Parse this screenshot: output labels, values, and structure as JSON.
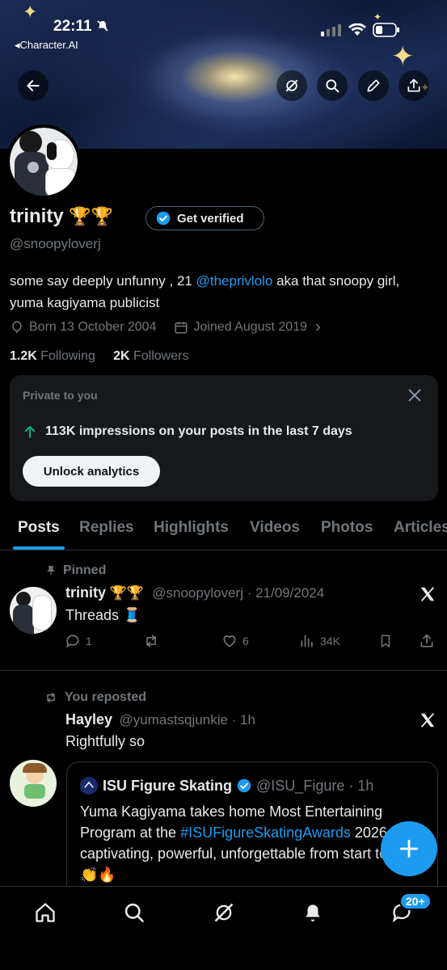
{
  "status_bar": {
    "time": "22:11",
    "back_app": "◂Character.AI"
  },
  "profile": {
    "name": "trinity",
    "name_emojis": "🏆🏆",
    "verify_label": "Get verified",
    "handle": "@snoopyloverj",
    "bio_before": "some say deeply unfunny , 21 ",
    "bio_link": "@theprivlolo",
    "bio_after": " aka that snoopy girl, yuma kagiyama publicist",
    "born": "Born 13 October 2004",
    "joined": "Joined August 2019",
    "following_count": "1.2K",
    "following_label": "Following",
    "followers_count": "2K",
    "followers_label": "Followers"
  },
  "analytics_card": {
    "title": "Private to you",
    "text": "113K impressions on your posts in the last 7 days",
    "button": "Unlock analytics"
  },
  "tabs": [
    "Posts",
    "Replies",
    "Highlights",
    "Videos",
    "Photos",
    "Articles"
  ],
  "pinned_post": {
    "pinned_label": "Pinned",
    "name": "trinity",
    "name_emojis": "🏆🏆",
    "handle_date": "@snoopyloverj · 21/09/2024",
    "text": "Threads 🧵",
    "replies": "1",
    "likes": "6",
    "views": "34K"
  },
  "repost": {
    "repost_label": "You reposted",
    "name": "Hayley",
    "handle_time": "@yumastsqjunkie · 1h",
    "text": "Rightfully so",
    "quote": {
      "name": "ISU Figure Skating",
      "handle_time": "@ISU_Figure · 1h",
      "text_before": "Yuma Kagiyama takes home Most Entertaining Program at the ",
      "hashtag": "#ISUFigureSkatingAwards",
      "text_after": " 2026, captivating, powerful, unforgettable from start to finish 👏🔥"
    }
  },
  "notifications_badge": "20+",
  "colors": {
    "accent": "#1d9bf0",
    "background": "#000000",
    "muted": "#71767b",
    "card": "#16181c"
  }
}
